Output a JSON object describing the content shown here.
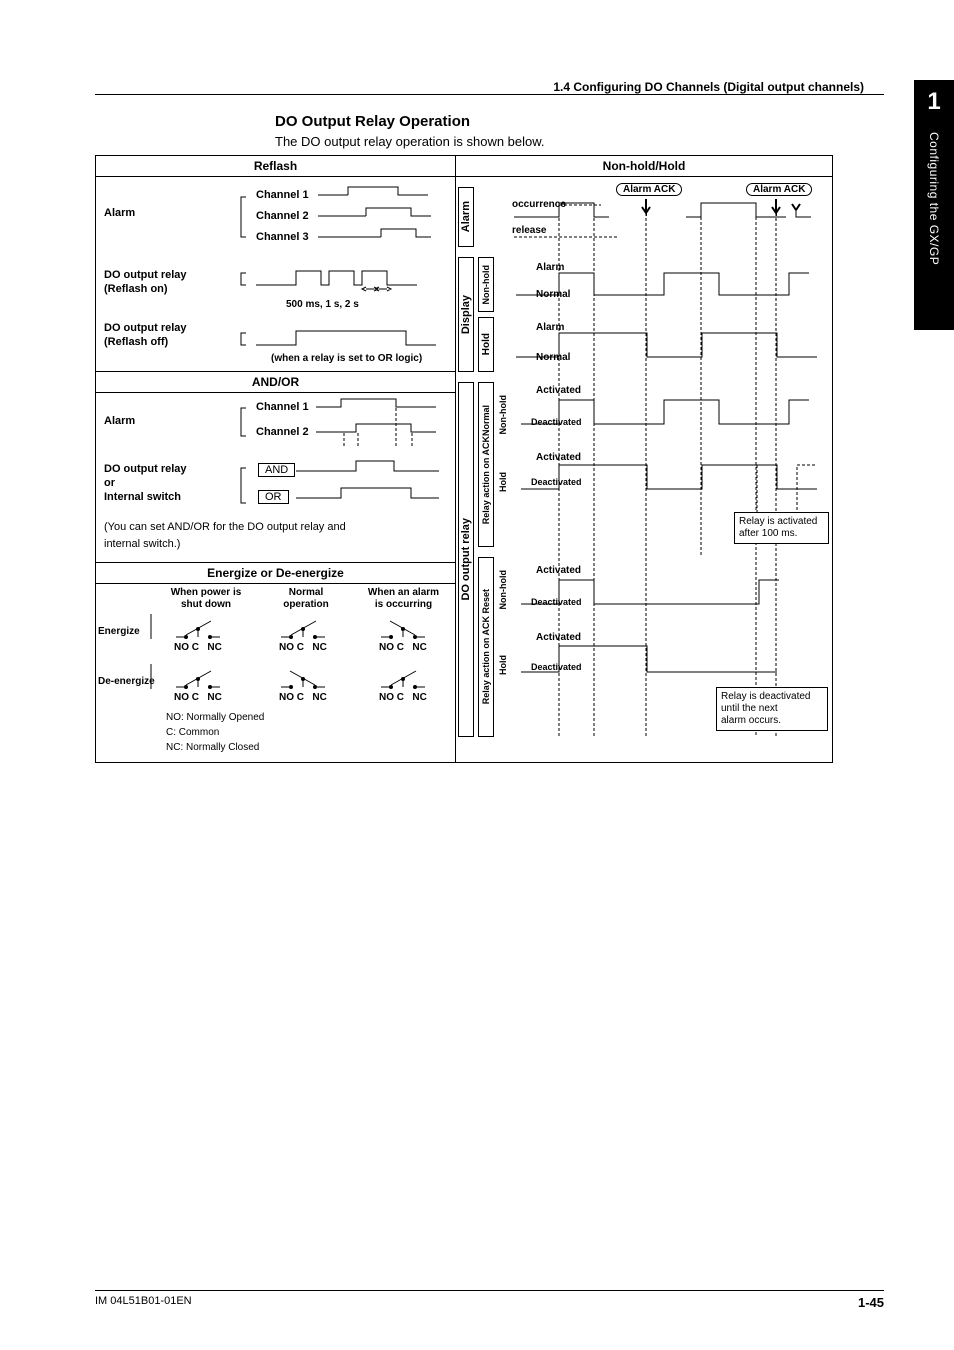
{
  "header": {
    "section": "1.4  Configuring DO Channels (Digital output channels)"
  },
  "sidetab": {
    "number": "1",
    "text": "Configuring the GX/GP"
  },
  "title": "DO Output Relay Operation",
  "lead": "The DO output relay operation is shown below.",
  "left": {
    "reflash_hdr": "Reflash",
    "alarm": "Alarm",
    "ch1": "Channel 1",
    "ch2": "Channel 2",
    "ch3": "Channel 3",
    "relay_on": "DO output relay",
    "relay_on2": "(Reflash on)",
    "timing": "500 ms, 1 s, 2 s",
    "relay_off": "DO output relay",
    "relay_off2": "(Reflash off)",
    "or_note": "(when a relay is set to OR logic)",
    "andor_hdr": "AND/OR",
    "and": "AND",
    "or": "OR",
    "relay_or": "DO output relay",
    "relay_or2": "or",
    "relay_or3": "Internal switch",
    "andor_note": "(You can set AND/OR for the DO output relay and",
    "andor_note2": "internal switch.)",
    "ende_hdr": "Energize or De-energize",
    "col_a": "When power is",
    "col_a2": "shut down",
    "col_b": "Normal",
    "col_b2": "operation",
    "col_c": "When an alarm",
    "col_c2": "is occurring",
    "energize": "Energize",
    "deenergize": "De-energize",
    "no": "NO",
    "c": "C",
    "nc": "NC",
    "leg1": "NO: Normally Opened",
    "leg2": "C: Common",
    "leg3": "NC: Normally Closed"
  },
  "right": {
    "nonhold_hdr": "Non-hold/Hold",
    "alarm_v": "Alarm",
    "display_v": "Display",
    "do_v": "DO output relay",
    "nonhold_v": "Non-hold",
    "hold_v": "Hold",
    "ackn_v": "Relay action on ACKNormal",
    "ackr_v": "Relay action on ACK Reset",
    "occurrence": "occurrence",
    "release": "release",
    "alarm": "Alarm",
    "normal": "Normal",
    "activated": "Activated",
    "deactivated": "Deactivated",
    "ack": "Alarm ACK",
    "note1": "Relay is activated",
    "note1b": "after 100 ms.",
    "note2a": "Relay is deactivated",
    "note2b": "until the next",
    "note2c": "alarm occurs."
  },
  "footer": {
    "doc": "IM 04L51B01-01EN",
    "page": "1-45"
  }
}
